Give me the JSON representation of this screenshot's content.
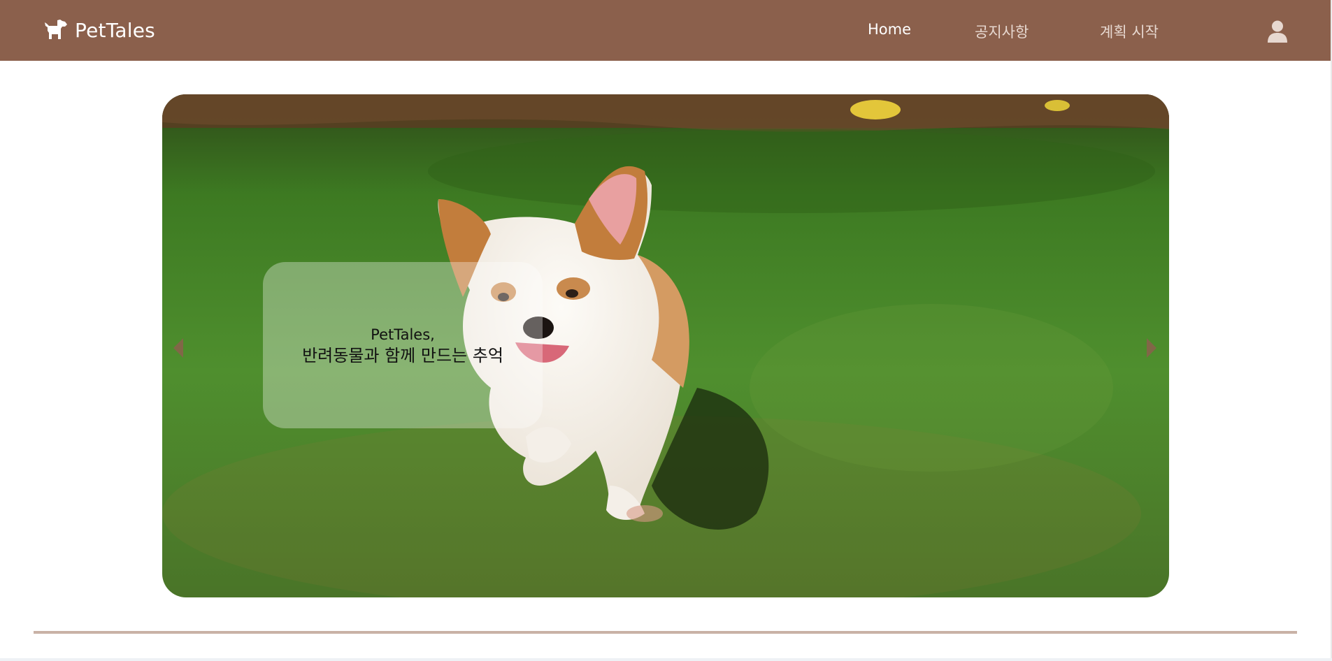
{
  "header": {
    "brand_name": "PetTales",
    "brand_icon": "dog-icon",
    "nav": [
      {
        "label": "Home"
      },
      {
        "label": "공지사항"
      },
      {
        "label": "계획 시작"
      }
    ],
    "profile_icon": "user-icon"
  },
  "hero": {
    "caption_line1": "PetTales,",
    "caption_line2": "반려동물과 함께 만드는 추억",
    "prev_icon": "caret-left-icon",
    "next_icon": "caret-right-icon"
  },
  "colors": {
    "navbar": "#8b604c",
    "divider": "#c9b2a6",
    "arrow": "#8b604c"
  }
}
